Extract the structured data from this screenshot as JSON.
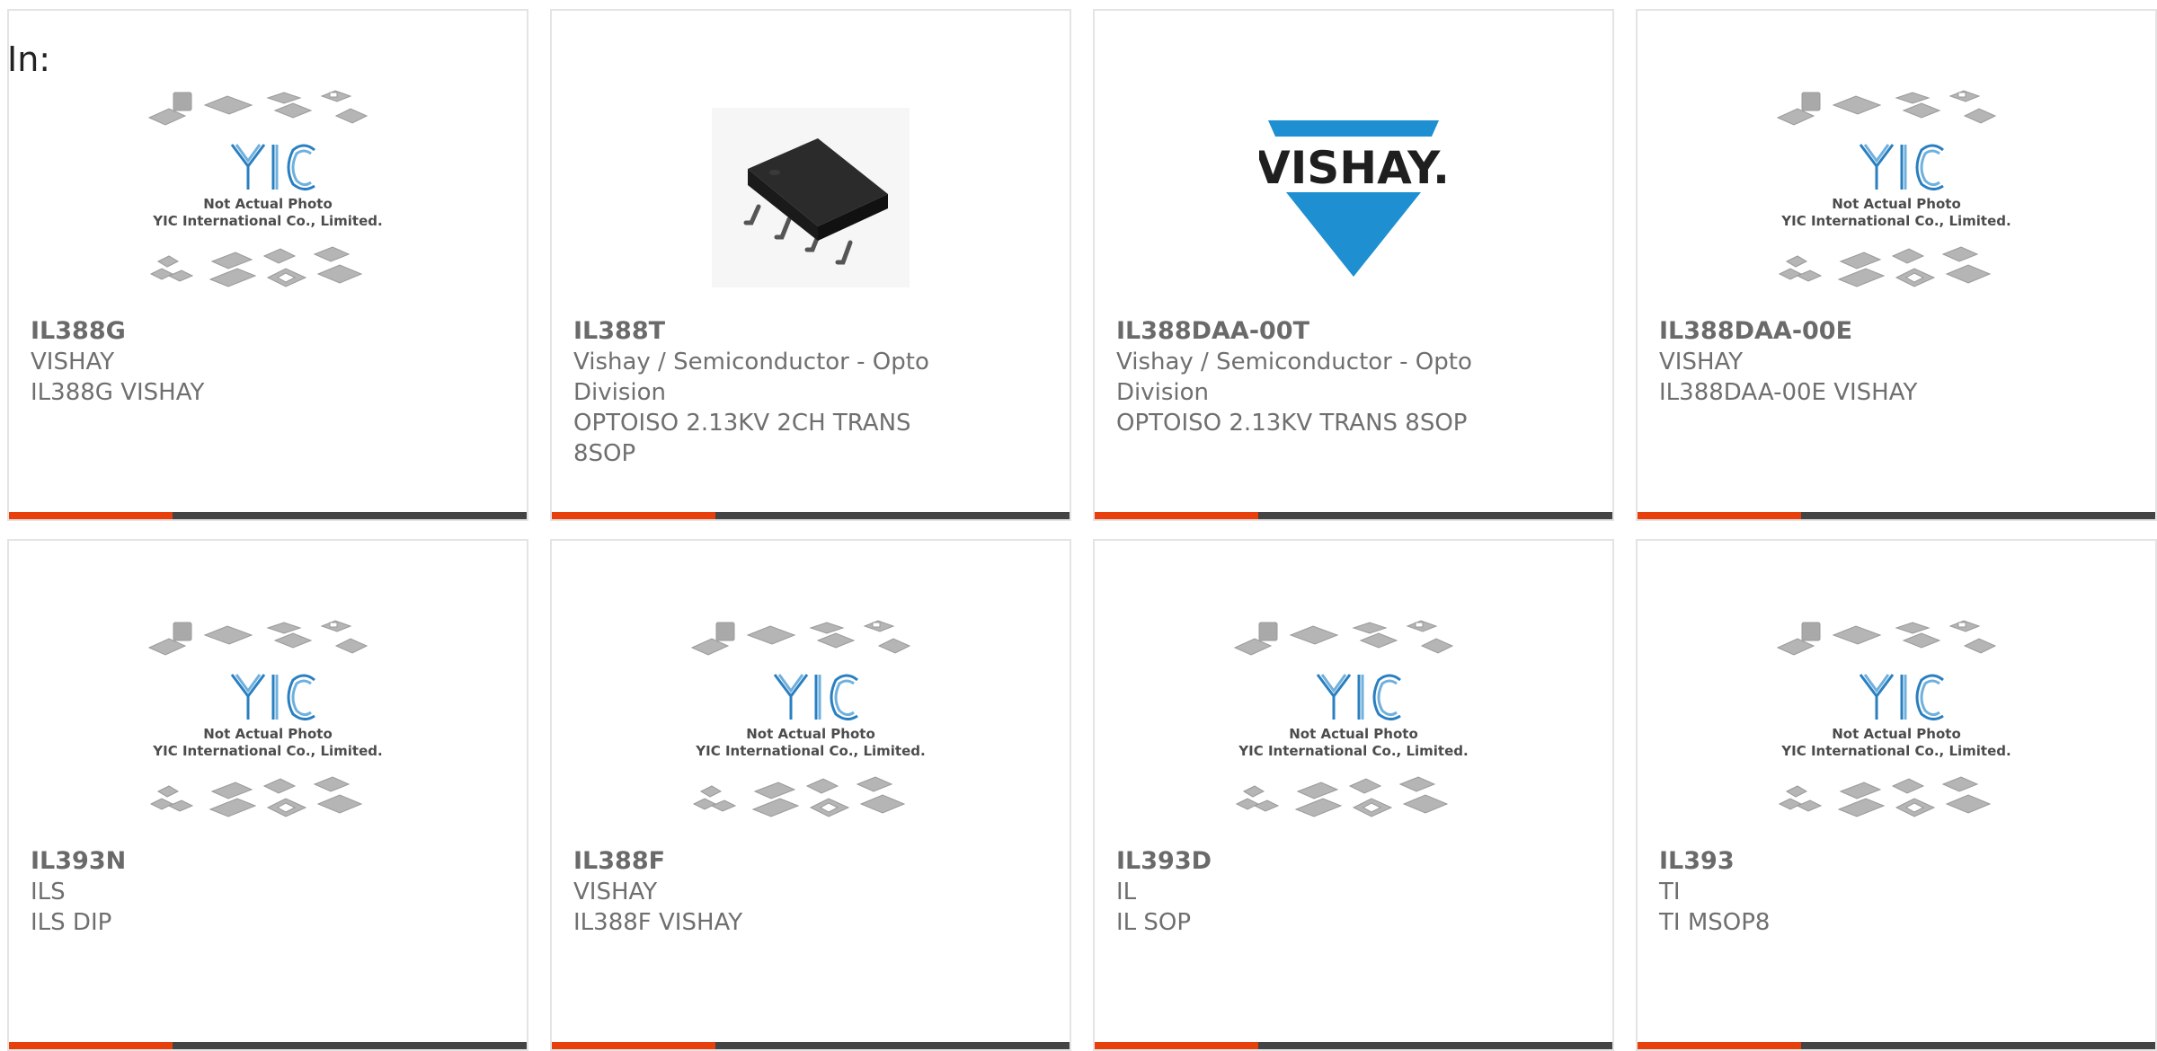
{
  "in_label": "In:",
  "placeholder": {
    "line1": "Not Actual Photo",
    "line2": "YIC International Co., Limited.",
    "logo": "YIC"
  },
  "vishay_logo_text": "VISHAY.",
  "colors": {
    "accent": "#e8400c",
    "bar": "#444444",
    "vishay_blue": "#1e8fd0",
    "yic_blue": "#2a7fc0"
  },
  "cards": [
    {
      "part": "IL388G",
      "maker": "VISHAY",
      "desc": "IL388G VISHAY",
      "image": "placeholder"
    },
    {
      "part": "IL388T",
      "maker": "Vishay / Semiconductor - Opto Division",
      "desc": "OPTOISO 2.13KV 2CH TRANS 8SOP",
      "image": "chip-photo"
    },
    {
      "part": "IL388DAA-00T",
      "maker": "Vishay / Semiconductor - Opto Division",
      "desc": "OPTOISO 2.13KV TRANS 8SOP",
      "image": "vishay-logo"
    },
    {
      "part": "IL388DAA-00E",
      "maker": "VISHAY",
      "desc": "IL388DAA-00E VISHAY",
      "image": "placeholder"
    },
    {
      "part": "IL393N",
      "maker": "ILS",
      "desc": "ILS DIP",
      "image": "placeholder"
    },
    {
      "part": "IL388F",
      "maker": "VISHAY",
      "desc": "IL388F VISHAY",
      "image": "placeholder"
    },
    {
      "part": "IL393D",
      "maker": "IL",
      "desc": "IL SOP",
      "image": "placeholder"
    },
    {
      "part": "IL393",
      "maker": "TI",
      "desc": "TI MSOP8",
      "image": "placeholder"
    }
  ]
}
